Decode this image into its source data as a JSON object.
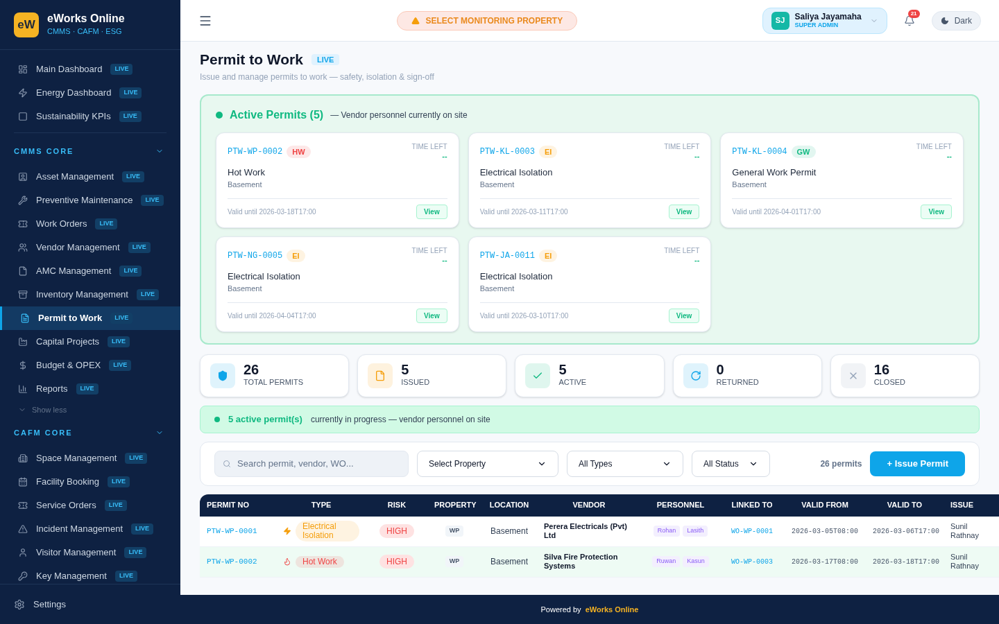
{
  "brand": {
    "logo": "eW",
    "name": "eWorks Online",
    "tagline": "CMMS · CAFM · ESG"
  },
  "sidebar": {
    "items": [
      {
        "label": "Main Dashboard",
        "badge": "LIVE",
        "selected": false
      },
      {
        "label": "Energy Dashboard",
        "badge": "LIVE",
        "selected": false
      },
      {
        "label": "Sustainability KPIs",
        "badge": "LIVE",
        "selected": false
      }
    ],
    "sections": [
      {
        "title": "CMMS CORE",
        "expanded": true,
        "toggle": "Show less",
        "items": [
          {
            "label": "Asset Management",
            "badge": "LIVE",
            "selected": false
          },
          {
            "label": "Preventive Maintenance",
            "badge": "LIVE",
            "selected": false
          },
          {
            "label": "Work Orders",
            "badge": "LIVE",
            "selected": false
          },
          {
            "label": "Vendor Management",
            "badge": "LIVE",
            "selected": false
          },
          {
            "label": "AMC Management",
            "badge": "LIVE",
            "selected": false
          },
          {
            "label": "Inventory Management",
            "badge": "LIVE",
            "selected": false
          },
          {
            "label": "Permit to Work",
            "badge": "LIVE",
            "selected": true
          },
          {
            "label": "Capital Projects",
            "badge": "LIVE",
            "selected": false
          },
          {
            "label": "Budget & OPEX",
            "badge": "LIVE",
            "selected": false
          },
          {
            "label": "Reports",
            "badge": "LIVE",
            "selected": false
          }
        ]
      },
      {
        "title": "CAFM CORE",
        "expanded": true,
        "items": [
          {
            "label": "Space Management",
            "badge": "LIVE",
            "selected": false
          },
          {
            "label": "Facility Booking",
            "badge": "LIVE",
            "selected": false
          },
          {
            "label": "Service Orders",
            "badge": "LIVE",
            "selected": false
          },
          {
            "label": "Incident Management",
            "badge": "LIVE",
            "selected": false
          },
          {
            "label": "Visitor Management",
            "badge": "LIVE",
            "selected": false
          },
          {
            "label": "Key Management",
            "badge": "LIVE",
            "selected": false
          }
        ]
      }
    ],
    "settings": "Settings"
  },
  "topbar": {
    "property_button": "SELECT MONITORING PROPERTY",
    "user": {
      "initials": "SJ",
      "name": "Saliya Jayamaha",
      "role": "SUPER ADMIN"
    },
    "notifications": "21",
    "theme_button": "Dark"
  },
  "page": {
    "title": "Permit to Work",
    "badge": "LIVE",
    "subtitle": "Issue and manage permits to work — safety, isolation & sign-off"
  },
  "active_panel": {
    "title": "Active Permits (5)",
    "subtitle": "— Vendor personnel currently on site",
    "permits": [
      {
        "id": "PTW-WP-0002",
        "tag": "HW",
        "color": "#ef4444",
        "title": "Hot Work",
        "location": "Basement",
        "time_label": "TIME LEFT",
        "time_value": "--",
        "valid": "Valid until 2026-03-18T17:00",
        "action": "View"
      },
      {
        "id": "PTW-KL-0003",
        "tag": "EI",
        "color": "#f59e0b",
        "title": "Electrical Isolation",
        "location": "Basement",
        "time_label": "TIME LEFT",
        "time_value": "--",
        "valid": "Valid until 2026-03-11T17:00",
        "action": "View"
      },
      {
        "id": "PTW-KL-0004",
        "tag": "GW",
        "color": "#10b981",
        "title": "General Work Permit",
        "location": "Basement",
        "time_label": "TIME LEFT",
        "time_value": "--",
        "valid": "Valid until 2026-04-01T17:00",
        "action": "View"
      },
      {
        "id": "PTW-NG-0005",
        "tag": "EI",
        "color": "#f59e0b",
        "title": "Electrical Isolation",
        "location": "Basement",
        "time_label": "TIME LEFT",
        "time_value": "--",
        "valid": "Valid until 2026-04-04T17:00",
        "action": "View"
      },
      {
        "id": "PTW-JA-0011",
        "tag": "EI",
        "color": "#f59e0b",
        "title": "Electrical Isolation",
        "location": "Basement",
        "time_label": "TIME LEFT",
        "time_value": "--",
        "valid": "Valid until 2026-03-10T17:00",
        "action": "View"
      }
    ]
  },
  "stats": [
    {
      "value": "26",
      "label": "TOTAL PERMITS",
      "color": "#0ea5e9"
    },
    {
      "value": "5",
      "label": "ISSUED",
      "color": "#f59e0b"
    },
    {
      "value": "5",
      "label": "ACTIVE",
      "color": "#10b981"
    },
    {
      "value": "0",
      "label": "RETURNED",
      "color": "#0ea5e9"
    },
    {
      "value": "16",
      "label": "CLOSED",
      "color": "#94a3b8"
    }
  ],
  "banner": {
    "highlight": "5 active permit(s)",
    "text": "currently in progress — vendor personnel on site"
  },
  "filters": {
    "search": {
      "placeholder": "Search permit, vendor, WO..."
    },
    "selects": [
      "Select Property",
      "All Types",
      "All Status"
    ],
    "count": "26 permits",
    "issue_button": "+ Issue Permit"
  },
  "table": {
    "columns": [
      "PERMIT NO",
      "TYPE",
      "RISK",
      "PROPERTY",
      "LOCATION",
      "VENDOR",
      "PERSONNEL",
      "LINKED TO",
      "VALID FROM",
      "VALID TO",
      "ISSUE"
    ],
    "rows": [
      {
        "highlighted": false,
        "permit_no": "PTW-WP-0001",
        "type": {
          "kind": "electrical",
          "label": "Electrical Isolation",
          "color": "#f59e0b"
        },
        "risk": "HIGH",
        "property": "WP",
        "location": "Basement",
        "vendor": "Perera Electricals (Pvt) Ltd",
        "personnel": [
          "Rohan",
          "Lasith"
        ],
        "linked_to": "WO-WP-0001",
        "valid_from": "2026-03-05T08:00",
        "valid_to": "2026-03-06T17:00",
        "issued_by": "Sunil Rathnay"
      },
      {
        "highlighted": true,
        "permit_no": "PTW-WP-0002",
        "type": {
          "kind": "hot-work",
          "label": "Hot Work",
          "color": "#ef4444"
        },
        "risk": "HIGH",
        "property": "WP",
        "location": "Basement",
        "vendor": "Silva Fire Protection Systems",
        "personnel": [
          "Ruwan",
          "Kasun"
        ],
        "linked_to": "WO-WP-0003",
        "valid_from": "2026-03-17T08:00",
        "valid_to": "2026-03-18T17:00",
        "issued_by": "Sunil Rathnay"
      }
    ]
  },
  "footer": {
    "prefix": "Powered by",
    "brand": "eWorks Online"
  }
}
